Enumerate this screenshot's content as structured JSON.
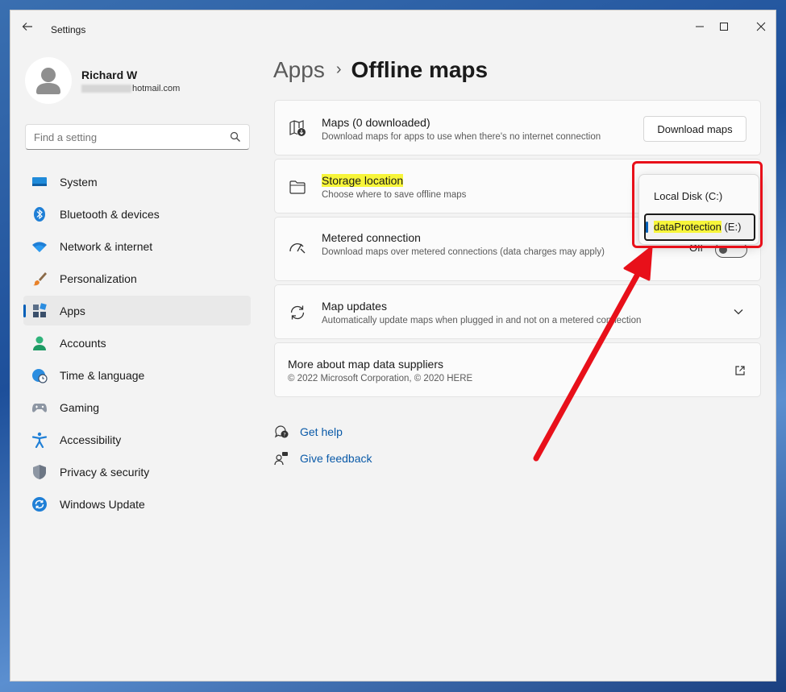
{
  "window": {
    "title": "Settings"
  },
  "profile": {
    "name": "Richard W",
    "email_suffix": "hotmail.com"
  },
  "search": {
    "placeholder": "Find a setting"
  },
  "nav": [
    {
      "label": "System",
      "icon": "monitor-icon",
      "active": false
    },
    {
      "label": "Bluetooth & devices",
      "icon": "bluetooth-icon",
      "active": false
    },
    {
      "label": "Network & internet",
      "icon": "wifi-icon",
      "active": false
    },
    {
      "label": "Personalization",
      "icon": "brush-icon",
      "active": false
    },
    {
      "label": "Apps",
      "icon": "apps-icon",
      "active": true
    },
    {
      "label": "Accounts",
      "icon": "person-icon",
      "active": false
    },
    {
      "label": "Time & language",
      "icon": "globe-clock-icon",
      "active": false
    },
    {
      "label": "Gaming",
      "icon": "gamepad-icon",
      "active": false
    },
    {
      "label": "Accessibility",
      "icon": "accessibility-icon",
      "active": false
    },
    {
      "label": "Privacy & security",
      "icon": "shield-icon",
      "active": false
    },
    {
      "label": "Windows Update",
      "icon": "update-icon",
      "active": false
    }
  ],
  "breadcrumb": {
    "parent": "Apps",
    "separator": "›",
    "current": "Offline maps"
  },
  "cards": {
    "maps": {
      "title": "Maps (0 downloaded)",
      "desc": "Download maps for apps to use when there's no internet connection",
      "button": "Download maps"
    },
    "storage": {
      "title": "Storage location",
      "desc": "Choose where to save offline maps"
    },
    "metered": {
      "title": "Metered connection",
      "desc": "Download maps over metered connections (data charges may apply)",
      "toggle_label": "Off",
      "toggle_on": false
    },
    "updates": {
      "title": "Map updates",
      "desc": "Automatically update maps when plugged in and not on a metered connection"
    },
    "about": {
      "title": "More about map data suppliers",
      "desc": "© 2022 Microsoft Corporation, © 2020 HERE"
    }
  },
  "dropdown": {
    "options": [
      "Local Disk (C:)",
      "dataProtection (E:)"
    ],
    "selected_name": "dataProtection",
    "selected_suffix": " (E:)"
  },
  "links": {
    "help": "Get help",
    "feedback": "Give feedback"
  },
  "colors": {
    "accent": "#005fb8",
    "highlight": "#f7f53a",
    "annotation": "#e8101a"
  }
}
